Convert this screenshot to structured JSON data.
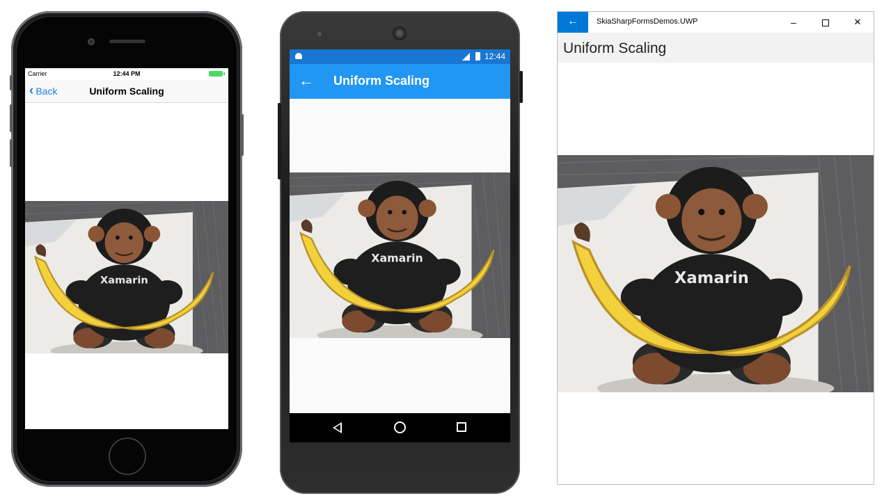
{
  "ios": {
    "status": {
      "carrier": "Carrier",
      "time": "12:44 PM"
    },
    "nav": {
      "back_label": "Back",
      "title": "Uniform Scaling"
    }
  },
  "android": {
    "status": {
      "time": "12:44"
    },
    "bar": {
      "title": "Uniform Scaling"
    }
  },
  "uwp": {
    "app_title": "SkiaSharpFormsDemos.UWP",
    "page_title": "Uniform Scaling",
    "minimize": "–",
    "close": "✕"
  },
  "photo": {
    "shirt_text": "Xamarin"
  },
  "colors": {
    "ios_accent": "#1a7cf5",
    "android_primary": "#2196f3",
    "android_status": "#1976d2",
    "uwp_accent": "#0078d7"
  }
}
